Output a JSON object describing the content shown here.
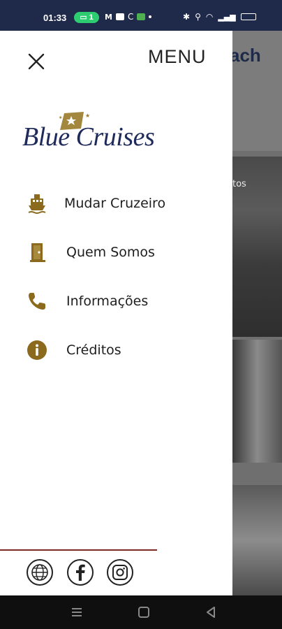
{
  "status_bar": {
    "time": "01:33",
    "badge_count": "1"
  },
  "drawer": {
    "title": "MENU",
    "logo_text": "Blue Cruises",
    "items": [
      {
        "label": "Mudar Cruzeiro",
        "icon": "ship-icon"
      },
      {
        "label": "Quem Somos",
        "icon": "door-icon"
      },
      {
        "label": "Informações",
        "icon": "phone-icon"
      },
      {
        "label": "Créditos",
        "icon": "info-icon"
      }
    ],
    "socials": [
      "globe-icon",
      "facebook-icon",
      "instagram-icon"
    ]
  },
  "background": {
    "title_fragment": "ach",
    "image_text_fragment": "tos"
  },
  "colors": {
    "status_bar": "#1f2a4a",
    "accent_gold": "#8b6a1e",
    "logo_blue": "#1e2a5a",
    "footer_line": "#7a2a22"
  }
}
